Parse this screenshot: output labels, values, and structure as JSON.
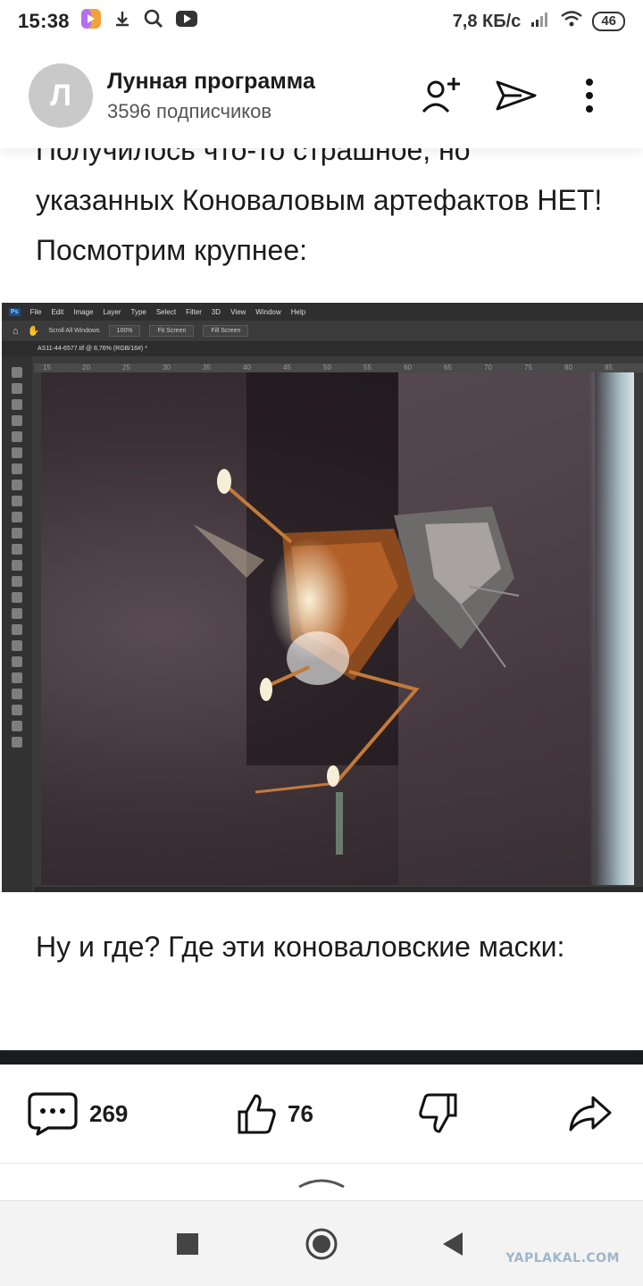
{
  "status_bar": {
    "time": "15:38",
    "network_speed": "7,8 КБ/с",
    "battery": "46"
  },
  "channel": {
    "avatar_letter": "Л",
    "name": "Лунная программа",
    "subscribers": "3596 подписчиков"
  },
  "article": {
    "paragraph1": "Получилось что-то страшное, но указанных Коноваловым артефактов НЕТ! Посмотрим крупнее:",
    "paragraph2": "Ну и где? Где эти коноваловские маски:"
  },
  "photoshop": {
    "menu": [
      "File",
      "Edit",
      "Image",
      "Layer",
      "Type",
      "Select",
      "Filter",
      "3D",
      "View",
      "Window",
      "Help"
    ],
    "options": [
      "Scroll All Windows",
      "100%",
      "Fit Screen",
      "Fill Screen"
    ],
    "doc_tab": "AS11-44-6577.tif @ 8,76% (RGB/16#) *",
    "ruler": [
      "15",
      "20",
      "25",
      "30",
      "35",
      "40",
      "45",
      "50",
      "55",
      "60",
      "65",
      "70",
      "75",
      "80",
      "85"
    ]
  },
  "actions": {
    "comments_count": "269",
    "likes_count": "76"
  },
  "watermark": "YAPLAKAL.COM",
  "icons": [
    "download-icon",
    "search-icon",
    "youtube-icon",
    "signal-icon",
    "wifi-icon",
    "subscribe-icon",
    "send-icon",
    "more-icon",
    "comment-icon",
    "like-icon",
    "dislike-icon",
    "share-icon",
    "collapse-chevron-icon",
    "recents-icon",
    "home-icon",
    "back-icon"
  ]
}
